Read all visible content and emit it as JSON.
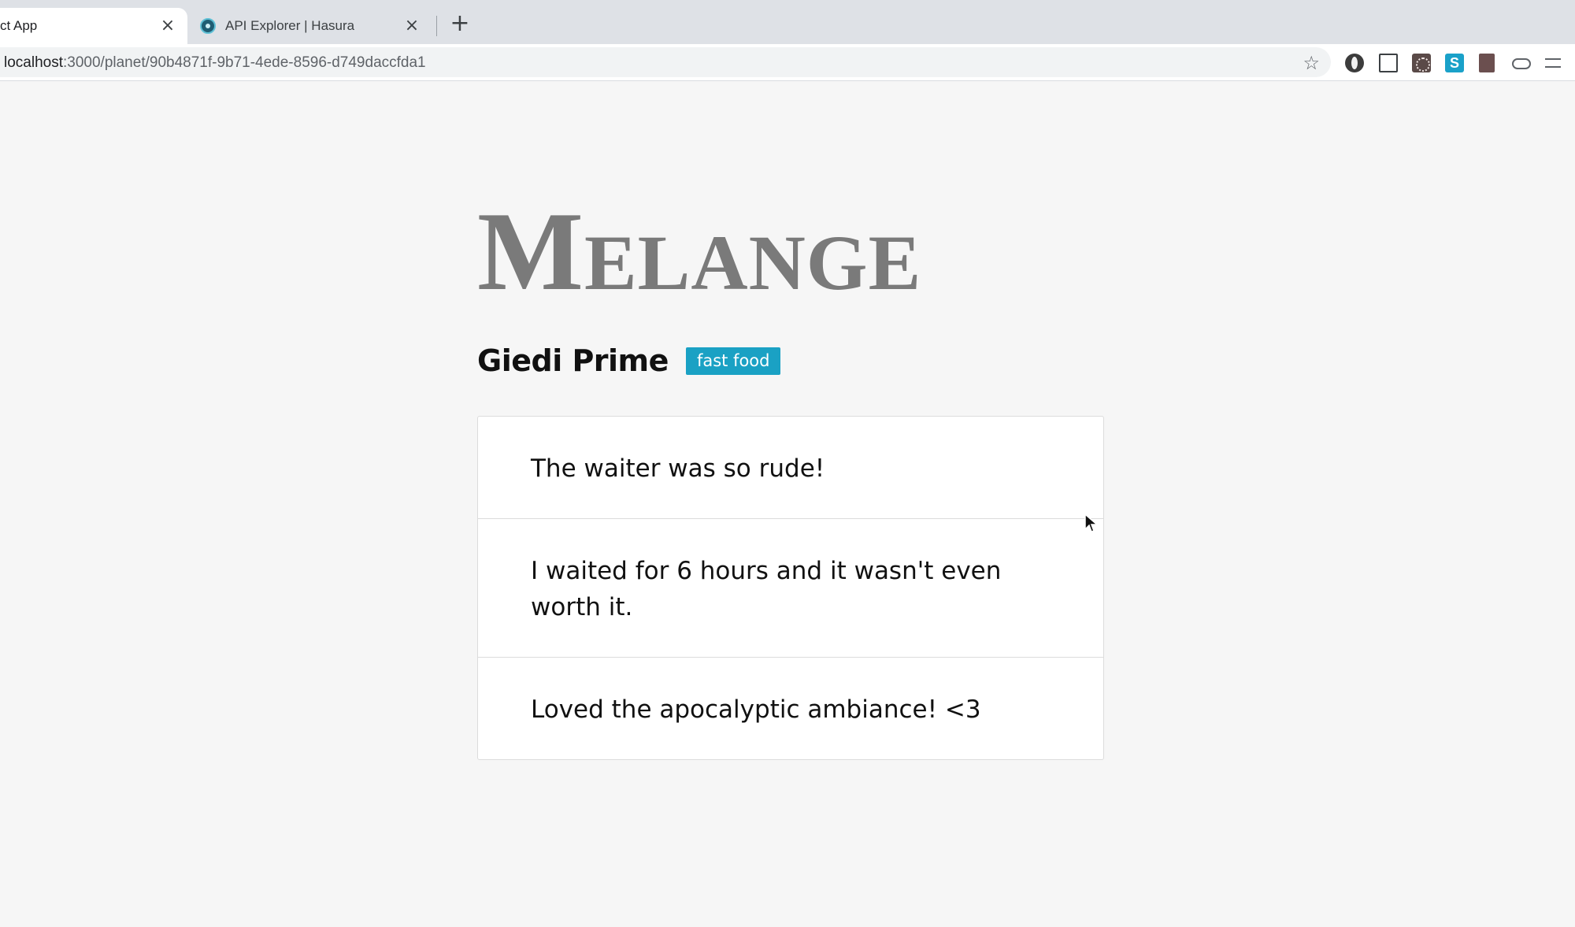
{
  "browser": {
    "tabs": [
      {
        "title": "ct App",
        "active": true,
        "close_icon": "close-icon"
      },
      {
        "title": "API Explorer | Hasura",
        "active": false,
        "favicon": "hasura-icon",
        "close_icon": "close-icon"
      }
    ],
    "new_tab_icon": "plus-icon",
    "url_host": "localhost",
    "url_path": ":3000/planet/90b4871f-9b71-4ede-8596-d749daccfda1",
    "bookmark_icon": "star-icon",
    "extension_icons": [
      "extension-1-icon",
      "screenshot-icon",
      "extension-3-icon",
      "skype-icon",
      "bookmark-book-icon",
      "cloud-icon",
      "reading-list-icon"
    ]
  },
  "page": {
    "logo": "Melange",
    "planet_name": "Giedi Prime",
    "tag": "fast food",
    "reviews": [
      "The waiter was so rude!",
      "I waited for 6 hours and it wasn't even worth it.",
      "Loved the apocalyptic ambiance! <3"
    ]
  },
  "colors": {
    "page_background": "#f6f6f6",
    "logo": "#7a7a7a",
    "tag_background": "#1aa1c4",
    "tag_text": "#ffffff",
    "text": "#111111"
  }
}
